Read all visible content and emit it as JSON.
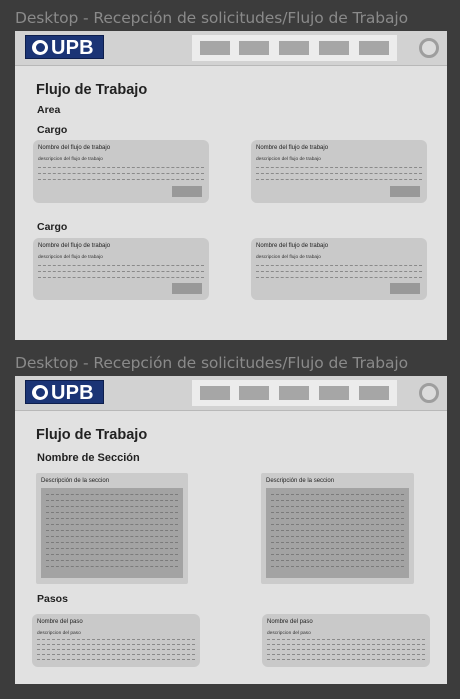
{
  "frames": [
    {
      "title": "Desktop - Recepción de solicitudes/Flujo de Trabajo",
      "logo_text": "UPB",
      "page_title": "Flujo de Trabajo",
      "area_label": "Area",
      "group1_label": "Cargo",
      "group2_label": "Cargo",
      "card_title": "Nombre del flujo de trabajo",
      "card_desc": "descripcion del flujo de trabajo"
    },
    {
      "title": "Desktop - Recepción de solicitudes/Flujo de Trabajo",
      "logo_text": "UPB",
      "page_title": "Flujo de Trabajo",
      "section_label": "Nombre de Sección",
      "section_card_title": "Descripción de la seccion",
      "steps_label": "Pasos",
      "step_title": "Nombre del paso",
      "step_desc": "descripcion del paso"
    }
  ],
  "icons": {
    "logo": "upb-logo-icon",
    "profile": "user-avatar-icon"
  },
  "colors": {
    "brand": "#1b3475",
    "canvas": "#3c3c3c",
    "page": "#e1e1e1"
  }
}
